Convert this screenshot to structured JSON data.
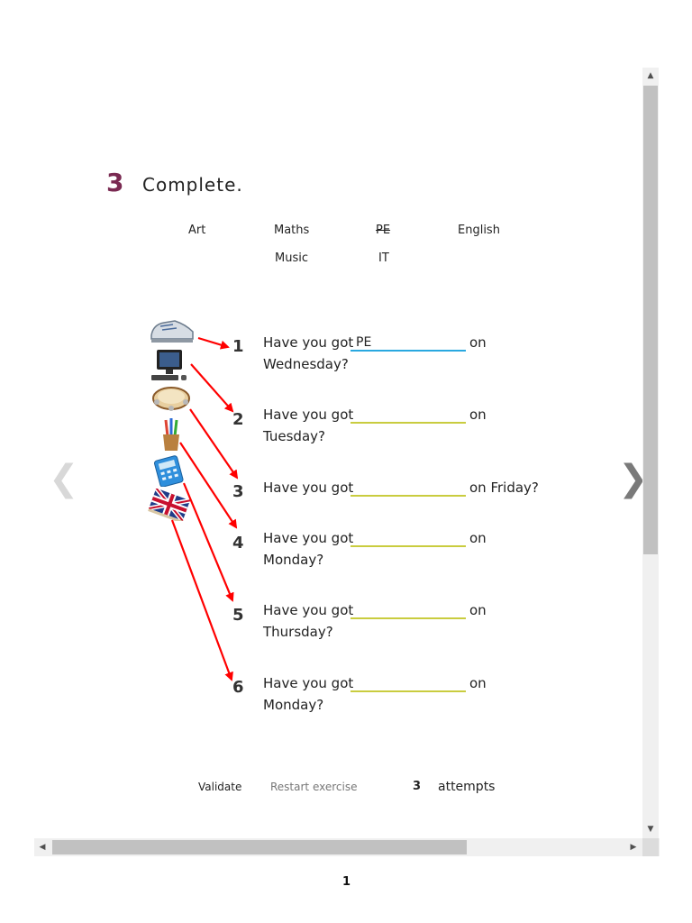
{
  "exercise": {
    "number": "3",
    "title": "Complete."
  },
  "word_bank": {
    "row1": [
      "Art",
      "Maths",
      "PE",
      "English"
    ],
    "row2": [
      "Music",
      "IT"
    ],
    "used": [
      "PE"
    ]
  },
  "questions": [
    {
      "number": "1",
      "prefix": "Have you got",
      "answer": "PE",
      "tail": "on",
      "line2": "Wednesday?",
      "picture": "trainers"
    },
    {
      "number": "2",
      "prefix": "Have you got",
      "answer": "",
      "tail": "on",
      "line2": "Tuesday?",
      "picture": "computer"
    },
    {
      "number": "3",
      "prefix": "Have you got",
      "answer": "",
      "tail": "on Friday?",
      "line2": "",
      "picture": "tambourine"
    },
    {
      "number": "4",
      "prefix": "Have you got",
      "answer": "",
      "tail": "on",
      "line2": "Monday?",
      "picture": "paint-brushes"
    },
    {
      "number": "5",
      "prefix": "Have you got",
      "answer": "",
      "tail": "on",
      "line2": "Thursday?",
      "picture": "calculator"
    },
    {
      "number": "6",
      "prefix": "Have you got",
      "answer": "",
      "tail": "on",
      "line2": "Monday?",
      "picture": "british-flag-book"
    }
  ],
  "controls": {
    "validate_label": "Validate",
    "restart_label": "Restart exercise",
    "attempts_count": "3",
    "attempts_label": "attempts"
  },
  "navigation": {
    "prev_icon": "chevron-left-icon",
    "next_icon": "chevron-right-icon"
  },
  "page_number": "1",
  "colors": {
    "accent_number": "#7a2a52",
    "arrow": "#ff0000",
    "active_underline": "#29a8e0",
    "underline": "#c9cc3f"
  }
}
